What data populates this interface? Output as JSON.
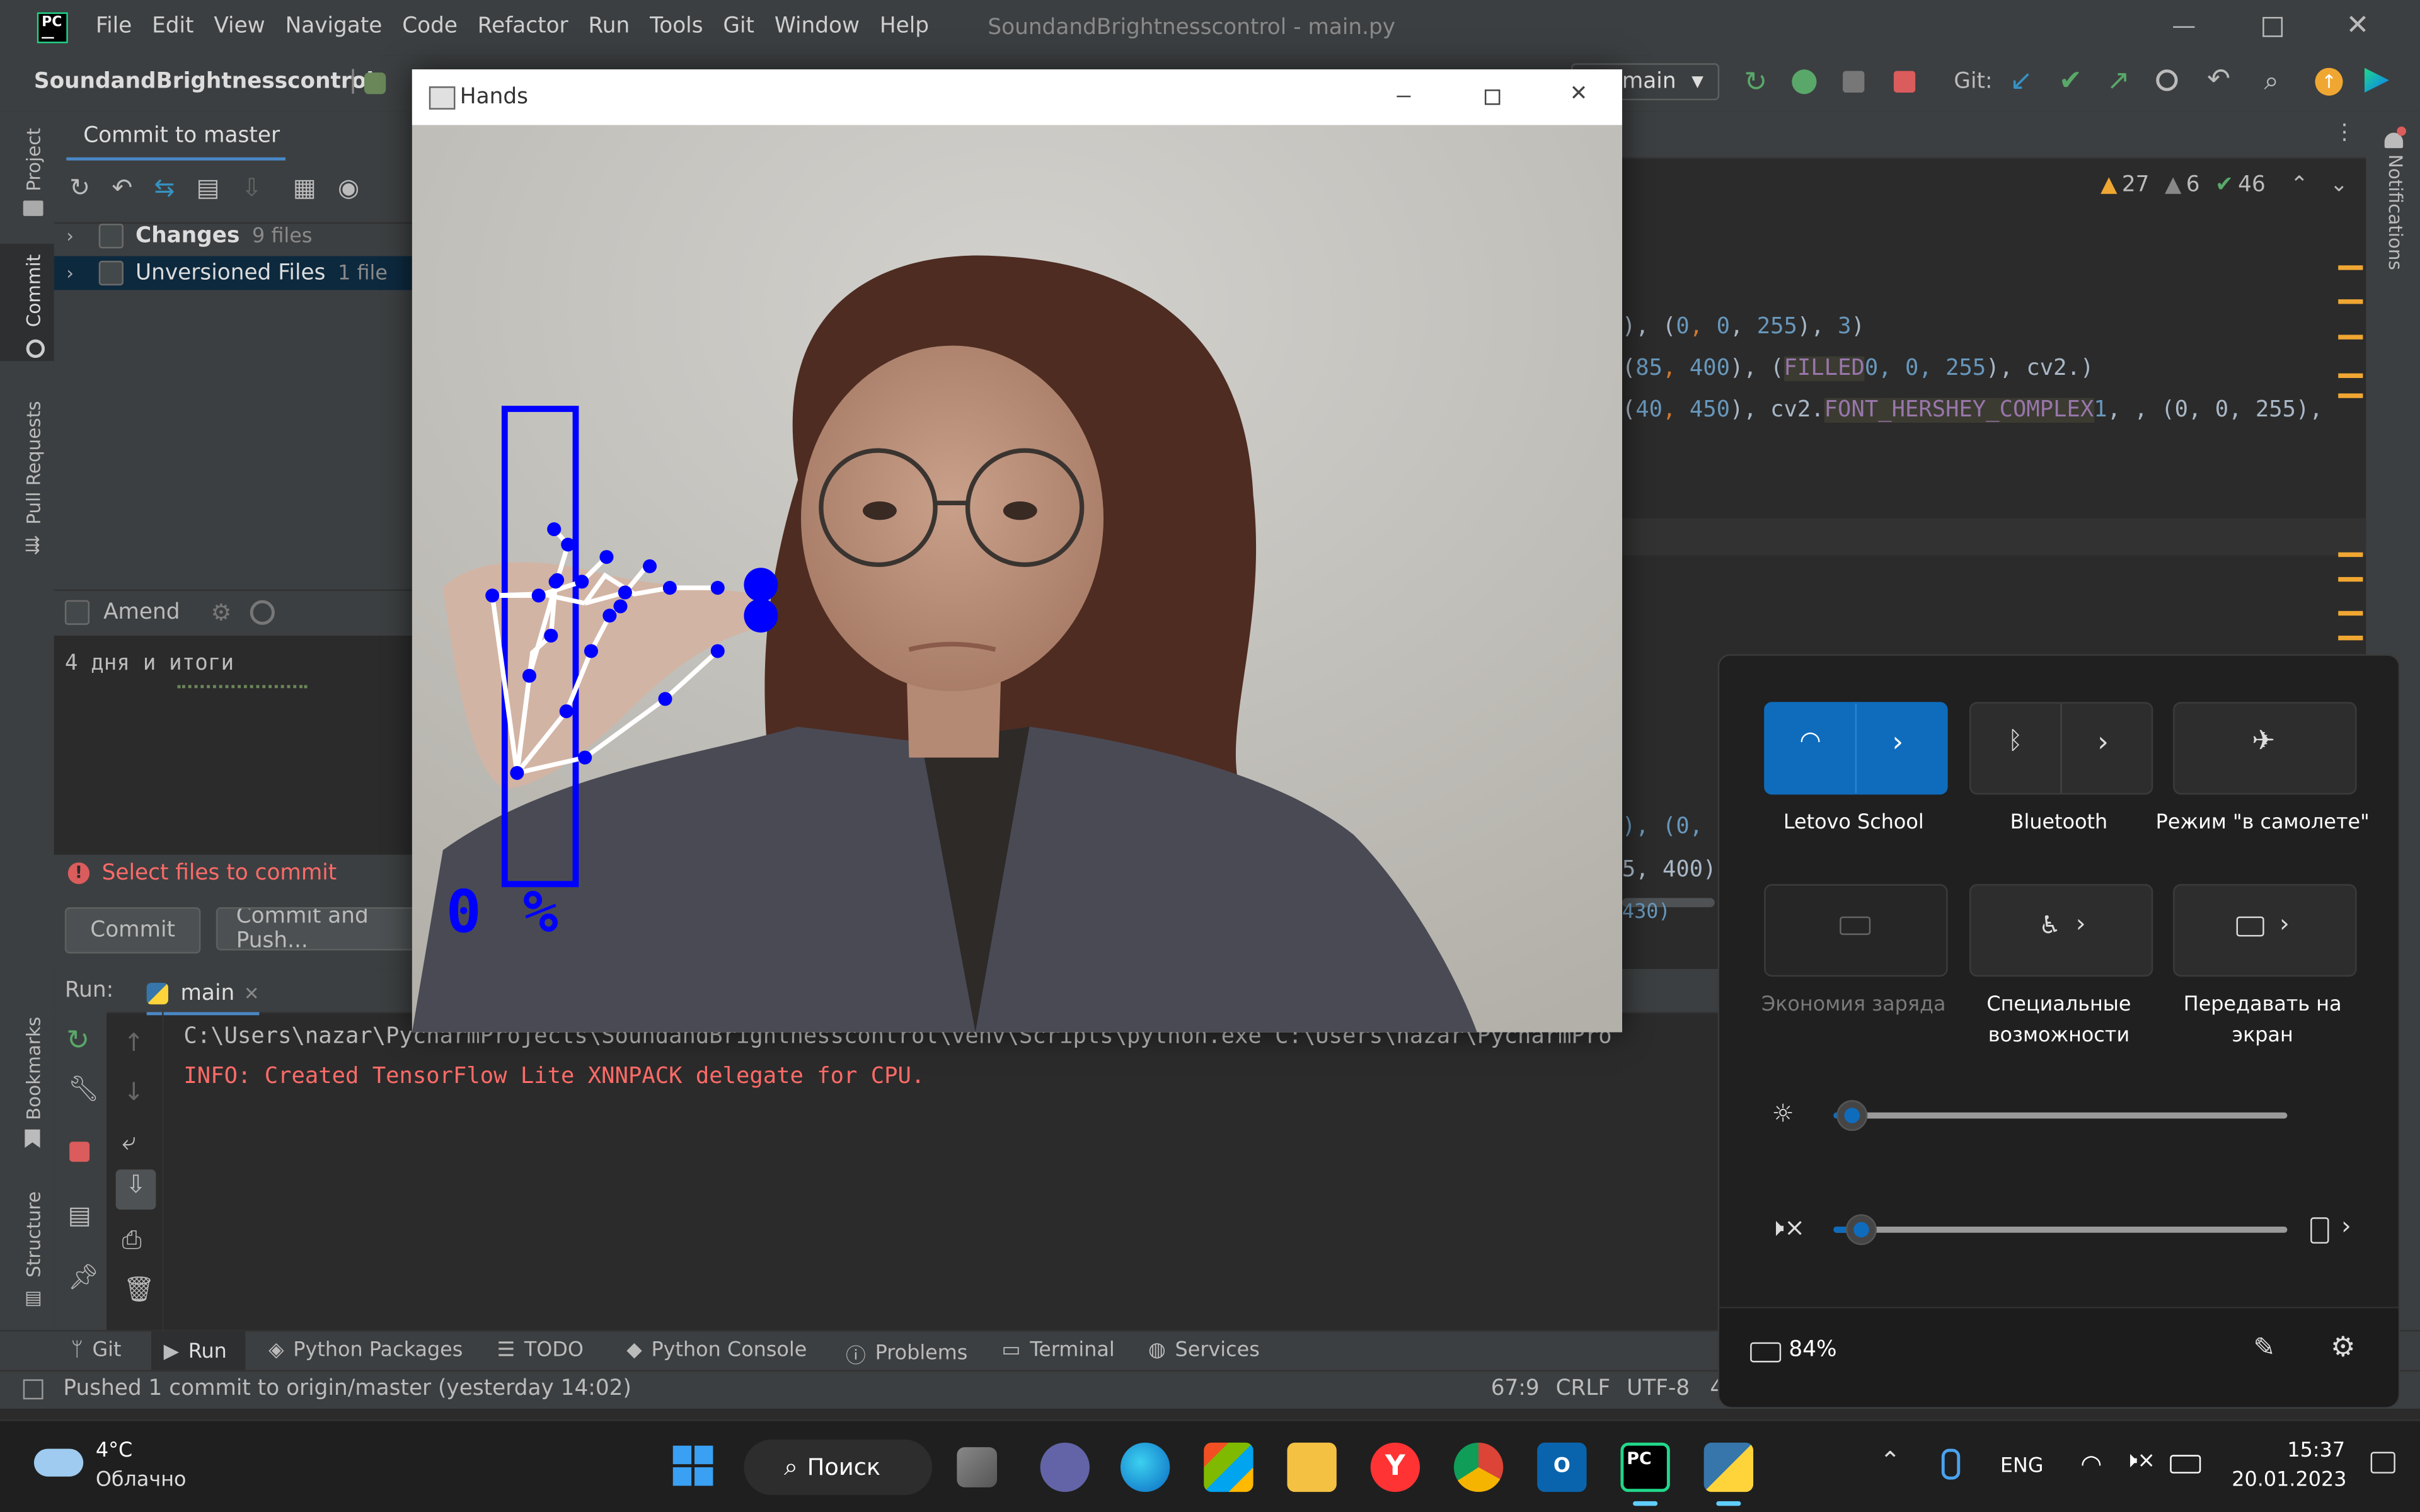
{
  "ide": {
    "window_title": "SoundandBrightnesscontrol - main.py",
    "menu": [
      "File",
      "Edit",
      "View",
      "Navigate",
      "Code",
      "Refactor",
      "Run",
      "Tools",
      "Git",
      "Window",
      "Help"
    ],
    "project_name": "SoundandBrightnesscontrol",
    "branch": "main",
    "git_label": "Git:",
    "left_tool_windows": [
      "Project",
      "Commit",
      "Pull Requests",
      "Bookmarks",
      "Structure"
    ],
    "right_tool_windows": [
      "Notifications"
    ],
    "commit": {
      "tab_title": "Commit to master",
      "groups": [
        {
          "label": "Changes",
          "count": "9 files"
        },
        {
          "label": "Unversioned Files",
          "count": "1 file"
        }
      ],
      "amend_label": "Amend",
      "message": "4 дня и итоги",
      "error": "Select files to commit",
      "commit_button": "Commit",
      "commit_push_button": "Commit and Push..."
    },
    "inspections": {
      "warnings": "27",
      "weak": "6",
      "ok": "46"
    },
    "code_lines": [
      {
        "pre": "), (",
        "num1": "0",
        "sep1": ", ",
        "num2": "0",
        "sep2": ", ",
        "num3": "255",
        "post": "), ",
        "num4": "3",
        "end": ")"
      },
      {
        "pre": "(",
        "num1": "85",
        "sep1": ", ",
        "num2": "400",
        "sep2": "), (",
        "num3": "0, 0, 255",
        "post": "), cv2.",
        "hl": "FILLED",
        "end": ")"
      },
      {
        "pre": "(",
        "num1": "40",
        "sep1": ", ",
        "num2": "450",
        "sep2": "), cv2.",
        "hl": "FONT_HERSHEY_COMPLEX",
        "post": ", ",
        "num3": "1",
        "end": ", (0, 0, 255),"
      }
    ],
    "code_lower": [
      "), (0,",
      "5, 400)",
      "430)"
    ],
    "run": {
      "label": "Run:",
      "config": "main",
      "line1": "C:\\Users\\nazar\\PycharmProjects\\SoundandBrightnesscontrol\\venv\\Scripts\\python.exe C:\\Users\\nazar\\PycharmPro",
      "line2": "INFO: Created TensorFlow Lite XNNPACK delegate for CPU."
    },
    "bottom_tabs": [
      "Git",
      "Run",
      "Python Packages",
      "TODO",
      "Python Console",
      "Problems",
      "Terminal",
      "Services"
    ],
    "status": {
      "message": "Pushed 1 commit to origin/master (yesterday 14:02)",
      "position": "67:9",
      "line_sep": "CRLF",
      "encoding": "UTF-8",
      "indent": "4"
    }
  },
  "hands_window": {
    "title": "Hands",
    "overlay_text": "0 %",
    "volume_level": 0
  },
  "quick_settings": {
    "tiles": [
      {
        "label": "Letovo School",
        "icon": "wifi-icon",
        "active": true
      },
      {
        "label": "Bluetooth",
        "icon": "bluetooth-icon",
        "active": false
      },
      {
        "label": "Режим \"в самолете\"",
        "icon": "airplane-icon",
        "active": false
      },
      {
        "label": "Экономия заряда",
        "icon": "battery-saver-icon",
        "active": false,
        "disabled": true
      },
      {
        "label": "Специальные возможности",
        "icon": "accessibility-icon",
        "active": false
      },
      {
        "label": "Передавать на экран",
        "icon": "cast-icon",
        "active": false
      }
    ],
    "brightness": 0.04,
    "volume": 0.06,
    "battery": "84%",
    "accent": "#0f6cbd"
  },
  "taskbar": {
    "weather_temp": "4°C",
    "weather_desc": "Облачно",
    "search_label": "Поиск",
    "language": "ENG",
    "time": "15:37",
    "date": "20.01.2023"
  }
}
